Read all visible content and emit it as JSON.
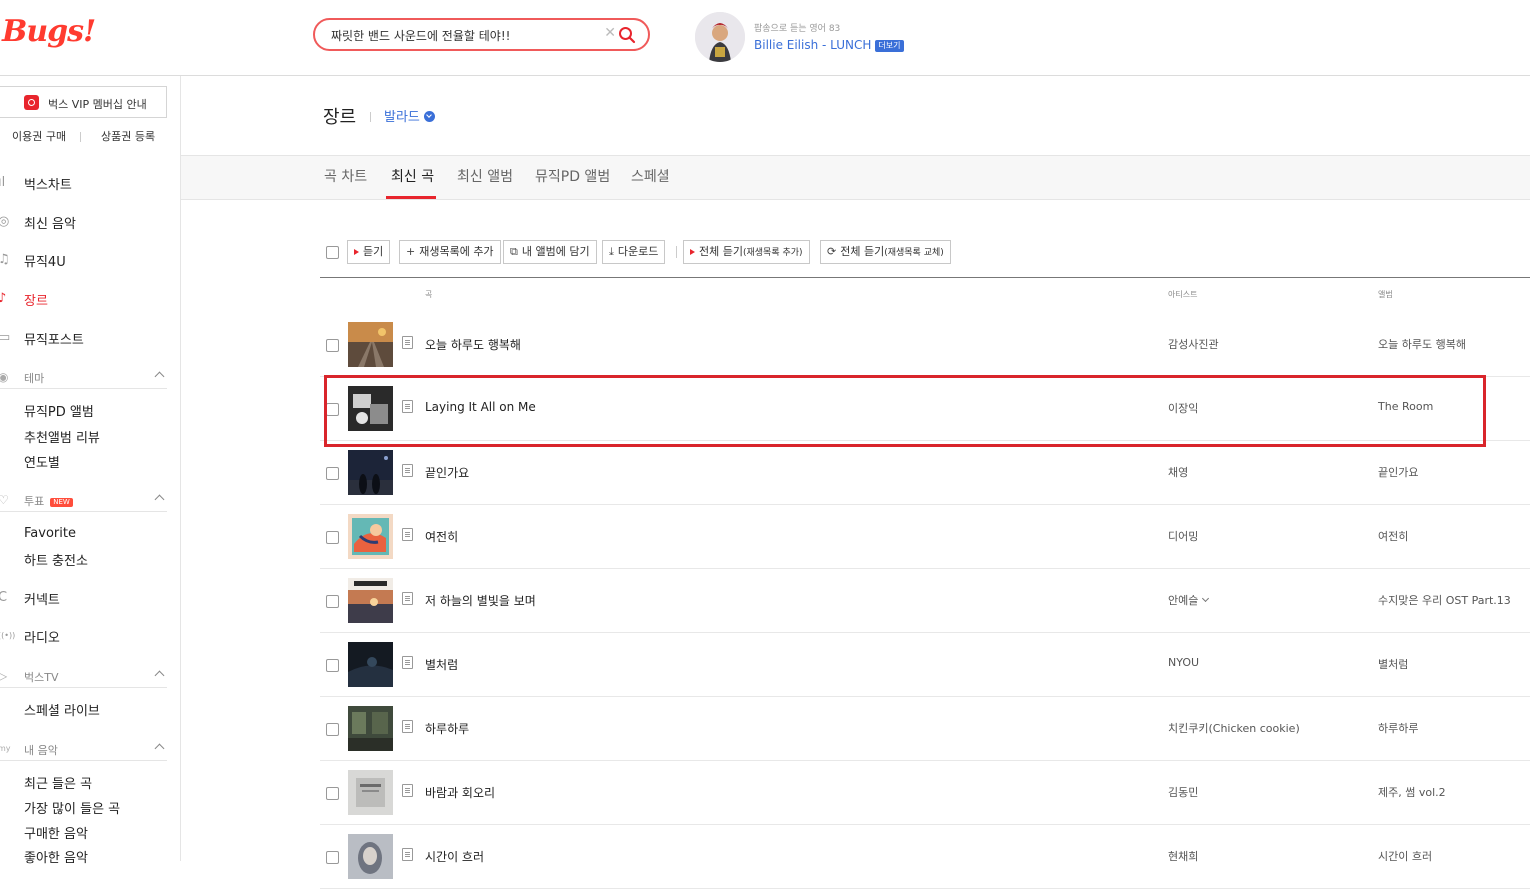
{
  "header": {
    "logo": "Bugs!",
    "search_value": "짜릿한 밴드 사운드에 전율할 테야!!",
    "clear_glyph": "✕",
    "now_playing": {
      "subtitle": "팝송으로 듣는 영어 83",
      "title": "Billie Eilish - LUNCH",
      "more_label": "더보기"
    }
  },
  "sidebar": {
    "vip_label": "벅스 VIP 멤버십 안내",
    "buy_pass": "이용권 구매",
    "register_coupon": "상품권 등록",
    "nav": [
      {
        "label": "벅스차트",
        "icon": "chart-icon",
        "glyph": "ıl"
      },
      {
        "label": "최신 음악",
        "icon": "new-music-icon",
        "glyph": "◎"
      },
      {
        "label": "뮤직4U",
        "icon": "music-note-icon",
        "glyph": "♫"
      },
      {
        "label": "장르",
        "icon": "guitar-icon",
        "glyph": "♪"
      },
      {
        "label": "뮤직포스트",
        "icon": "post-icon",
        "glyph": "▭"
      }
    ],
    "theme": {
      "label": "테마",
      "glyph": "◉",
      "items": [
        "뮤직PD 앨범",
        "추천앨범 리뷰",
        "연도별"
      ]
    },
    "vote": {
      "label": "투표",
      "badge": "NEW",
      "glyph": "♡",
      "items": [
        "Favorite",
        "하트 충전소"
      ]
    },
    "connect": {
      "label": "커넥트",
      "glyph": "C"
    },
    "radio": {
      "label": "라디오",
      "glyph": "((•))"
    },
    "bugstv": {
      "label": "벅스TV",
      "glyph": "▷",
      "items": [
        "스페셜 라이브"
      ]
    },
    "mymusic": {
      "label": "내 음악",
      "glyph": "my",
      "items": [
        "최근 들은 곡",
        "가장 많이 들은 곡",
        "구매한 음악",
        "좋아한 음악"
      ]
    }
  },
  "main": {
    "title": "장르",
    "genre": "발라드",
    "tabs": [
      "곡 차트",
      "최신 곡",
      "최신 앨범",
      "뮤직PD 앨범",
      "스페셜"
    ],
    "toolbar": {
      "listen": "듣기",
      "add_playlist": "재생목록에 추가",
      "add_album": "내 앨범에 담기",
      "download": "다운로드",
      "listen_all_add": "전체 듣기",
      "listen_all_add_note": "(재생목록 추가)",
      "listen_all_replace": "전체 듣기",
      "listen_all_replace_note": "(재생목록 교체)"
    },
    "columns": {
      "song": "곡",
      "artist": "아티스트",
      "album": "앨범"
    },
    "rows": [
      {
        "title": "오늘 하루도 행복해",
        "artist": "감성사진관",
        "album": "오늘 하루도 행복해"
      },
      {
        "title": "Laying It All on Me",
        "artist": "이장익",
        "album": "The Room"
      },
      {
        "title": "끝인가요",
        "artist": "채영",
        "album": "끝인가요"
      },
      {
        "title": "여전히",
        "artist": "디어밍",
        "album": "여전히"
      },
      {
        "title": "저 하늘의 별빛을 보며",
        "artist": "안예슬",
        "album": "수지맞은 우리 OST Part.13"
      },
      {
        "title": "별처럼",
        "artist": "NYOU",
        "album": "별처럼"
      },
      {
        "title": "하루하루",
        "artist": "치킨쿠키(Chicken cookie)",
        "album": "하루하루"
      },
      {
        "title": "바람과 회오리",
        "artist": "김동민",
        "album": "제주, 썸 vol.2"
      },
      {
        "title": "시간이 흐러",
        "artist": "현채희",
        "album": "시간이 흐러"
      }
    ]
  },
  "colors": {
    "accent": "#e8252d",
    "link": "#3a6fd8",
    "highlight": "#d9252b"
  }
}
